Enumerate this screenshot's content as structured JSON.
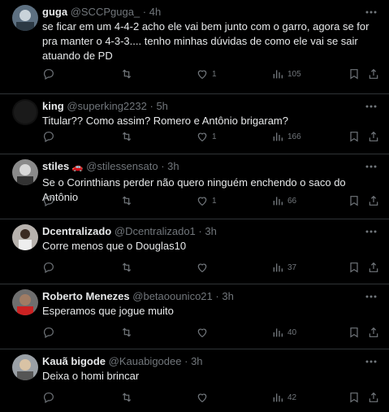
{
  "tweets": [
    {
      "name": "guga",
      "handle": "@SCCPguga_",
      "time": "4h",
      "text": "se ficar em um 4-4-2 acho ele vai bem junto com o garro, agora se for pra manter o 4-3-3.... tenho minhas dúvidas de como ele vai se sair atuando de PD",
      "likes": "1",
      "views": "105",
      "badge": ""
    },
    {
      "name": "king",
      "handle": "@superking2232",
      "time": "5h",
      "text": "Titular?? Como assim? Romero e Antônio brigaram?",
      "likes": "1",
      "views": "166",
      "badge": ""
    },
    {
      "name": "stiles",
      "handle": "@stilessensato",
      "time": "3h",
      "text": "Se o Corinthians perder não quero ninguém enchendo o saco do Antônio",
      "likes": "1",
      "views": "66",
      "badge": "🚗"
    },
    {
      "name": "Dcentralizado",
      "handle": "@Dcentralizado1",
      "time": "3h",
      "text": "Corre menos que o Douglas10",
      "likes": "",
      "views": "37",
      "badge": ""
    },
    {
      "name": "Roberto Menezes",
      "handle": "@betaoounico21",
      "time": "3h",
      "text": "Esperamos que jogue muito",
      "likes": "",
      "views": "40",
      "badge": ""
    },
    {
      "name": "Kauã bigode",
      "handle": "@Kauabigodee",
      "time": "3h",
      "text": "Deixa o homi brincar",
      "likes": "",
      "views": "42",
      "badge": ""
    }
  ],
  "separator": "·"
}
